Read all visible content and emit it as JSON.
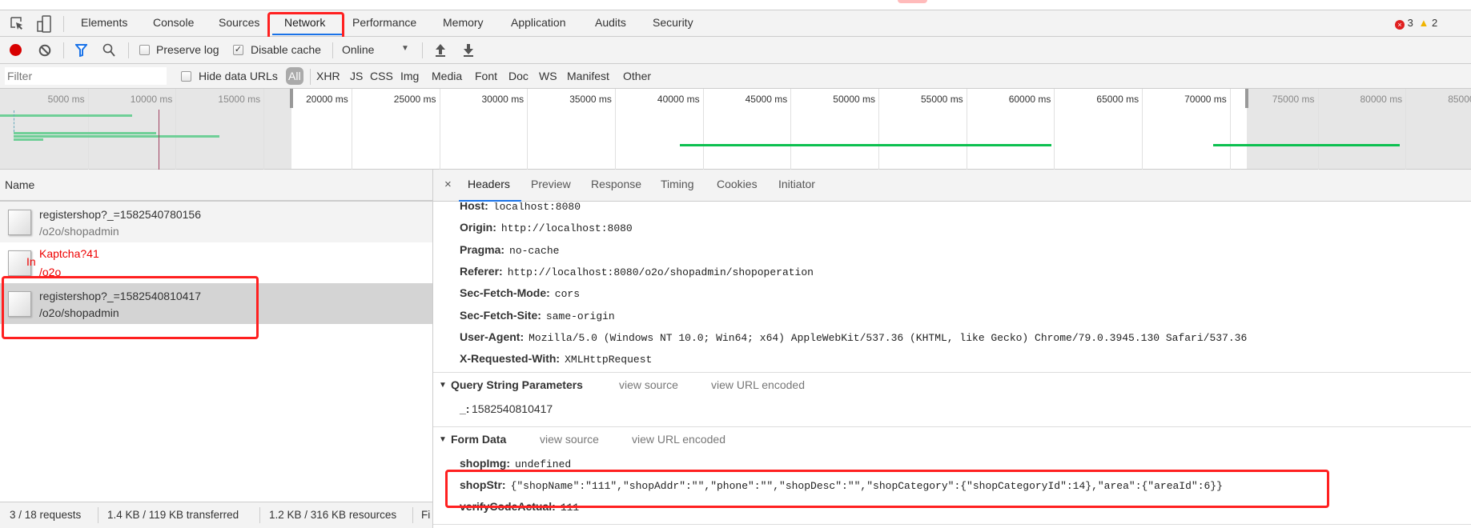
{
  "devtools": {
    "tabs": [
      "Elements",
      "Console",
      "Sources",
      "Network",
      "Performance",
      "Memory",
      "Application",
      "Audits",
      "Security"
    ],
    "active_tab": "Network",
    "errors": "3",
    "warnings": "2"
  },
  "toolbar": {
    "preserve_log": "Preserve log",
    "preserve_log_checked": false,
    "disable_cache": "Disable cache",
    "disable_cache_checked": true,
    "throttle": "Online"
  },
  "filter": {
    "placeholder": "Filter",
    "hide_data_urls": "Hide data URLs",
    "types": [
      "All",
      "XHR",
      "JS",
      "CSS",
      "Img",
      "Media",
      "Font",
      "Doc",
      "WS",
      "Manifest",
      "Other"
    ],
    "active_type": "All"
  },
  "timeline": {
    "ticks": [
      5000,
      10000,
      15000,
      20000,
      25000,
      30000,
      35000,
      40000,
      45000,
      50000,
      55000,
      60000,
      65000,
      70000,
      75000,
      80000,
      85000
    ],
    "tick_unit": "ms",
    "selection_ms": [
      16590,
      70970
    ],
    "marker_ms": 9025,
    "bars_ms": [
      [
        0,
        7520
      ],
      [
        775,
        8890
      ],
      [
        775,
        12490
      ],
      [
        775,
        2460
      ],
      [
        38700,
        59850
      ],
      [
        69050,
        79650
      ]
    ],
    "colors": {
      "bar": "#0cc050",
      "marker": "#a04060"
    }
  },
  "requests": {
    "header": "Name",
    "items": [
      {
        "name": "registershop?_=1582540780156",
        "path": "/o2o/shopadmin",
        "error": false
      },
      {
        "name": "Kaptcha?41",
        "path": "/o2o",
        "overlay": "In",
        "error": true
      },
      {
        "name": "registershop?_=1582540810417",
        "path": "/o2o/shopadmin",
        "error": false,
        "selected": true
      }
    ]
  },
  "status": {
    "requests": "3 / 18 requests",
    "transferred": "1.4 KB / 119 KB transferred",
    "resources": "1.2 KB / 316 KB resources",
    "finish": "Fi"
  },
  "details": {
    "tabs": [
      "Headers",
      "Preview",
      "Response",
      "Timing",
      "Cookies",
      "Initiator"
    ],
    "active_tab": "Headers",
    "request_headers": [
      {
        "k": "Host:",
        "v": "localhost:8080"
      },
      {
        "k": "Origin:",
        "v": "http://localhost:8080"
      },
      {
        "k": "Pragma:",
        "v": "no-cache"
      },
      {
        "k": "Referer:",
        "v": "http://localhost:8080/o2o/shopadmin/shopoperation"
      },
      {
        "k": "Sec-Fetch-Mode:",
        "v": "cors"
      },
      {
        "k": "Sec-Fetch-Site:",
        "v": "same-origin"
      },
      {
        "k": "User-Agent:",
        "v": "Mozilla/5.0 (Windows NT 10.0; Win64; x64) AppleWebKit/537.36 (KHTML, like Gecko) Chrome/79.0.3945.130 Safari/537.36"
      },
      {
        "k": "X-Requested-With:",
        "v": "XMLHttpRequest"
      }
    ],
    "query": {
      "title": "Query String Parameters",
      "view_source": "view source",
      "view_url": "view URL encoded",
      "params": [
        {
          "k": "_:",
          "v": "1582540810417"
        }
      ]
    },
    "form": {
      "title": "Form Data",
      "view_source": "view source",
      "view_url": "view URL encoded",
      "params": [
        {
          "k": "shopImg:",
          "v": "undefined"
        },
        {
          "k": "shopStr:",
          "v": "{\"shopName\":\"111\",\"shopAddr\":\"\",\"phone\":\"\",\"shopDesc\":\"\",\"shopCategory\":{\"shopCategoryId\":14},\"area\":{\"areaId\":6}}"
        },
        {
          "k": "verifyCodeActual:",
          "v": "111"
        }
      ]
    }
  }
}
